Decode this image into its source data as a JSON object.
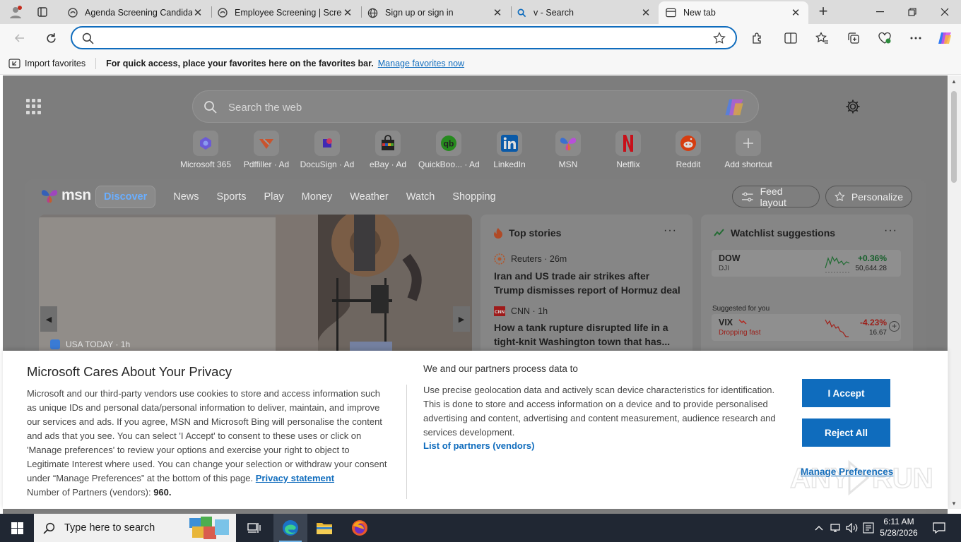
{
  "tabs": [
    {
      "title": "Agenda Screening Candidate",
      "icon": "edge-document-icon",
      "active": false
    },
    {
      "title": "Employee Screening | Screen",
      "icon": "edge-document-icon",
      "active": false
    },
    {
      "title": "Sign up or sign in",
      "icon": "globe-icon",
      "active": false
    },
    {
      "title": "v - Search",
      "icon": "search-icon",
      "active": false
    },
    {
      "title": "New tab",
      "icon": "newtab-icon",
      "active": true
    }
  ],
  "tab_close": "✕",
  "newtab_label": "+",
  "address": {
    "value": "",
    "placeholder": ""
  },
  "favorites": {
    "import_label": "Import favorites",
    "message": "For quick access, place your favorites here on the favorites bar.",
    "manage_link": "Manage favorites now"
  },
  "newtab": {
    "search_placeholder": "Search the web",
    "shortcuts": [
      {
        "label": "Microsoft 365",
        "color": "#6b5bd6"
      },
      {
        "label": "Pdffiller · Ad",
        "color": "#e8572d"
      },
      {
        "label": "DocuSign · Ad",
        "color": "#4b2bd8"
      },
      {
        "label": "eBay · Ad",
        "color": "#2d2d2d"
      },
      {
        "label": "QuickBoo... · Ad",
        "color": "#2ca01c"
      },
      {
        "label": "LinkedIn",
        "color": "#0a66c2"
      },
      {
        "label": "MSN",
        "color": "#8a4fd8"
      },
      {
        "label": "Netflix",
        "color": "#e50914"
      },
      {
        "label": "Reddit",
        "color": "#ff4500"
      },
      {
        "label": "Add shortcut",
        "color": "#bdbdbd"
      }
    ]
  },
  "msn": {
    "logo_text": "msn",
    "nav": [
      "Discover",
      "News",
      "Sports",
      "Play",
      "Money",
      "Weather",
      "Watch",
      "Shopping"
    ],
    "feed_layout": "Feed layout",
    "personalize": "Personalize",
    "hero_source": "USA TODAY · 1h",
    "top_stories": {
      "title": "Top stories",
      "more": "···",
      "items": [
        {
          "source": "Reuters · 26m",
          "title": "Iran and US trade air strikes after Trump dismisses report of Hormuz deal"
        },
        {
          "source": "CNN · 1h",
          "title": "How a tank rupture disrupted life in a tight-knit Washington town that has..."
        }
      ]
    },
    "watchlist": {
      "title": "Watchlist suggestions",
      "more": "···",
      "suggested_label": "Suggested for you",
      "stocks": [
        {
          "name": "DOW",
          "sub": "DJI",
          "change": "+0.36%",
          "value": "50,644.28",
          "color": "#155f2a"
        },
        {
          "name": "VIX",
          "sub": "Dropping fast",
          "change": "-4.23%",
          "value": "16.67",
          "color": "#b3261e"
        }
      ]
    }
  },
  "consent": {
    "title": "Microsoft Cares About Your Privacy",
    "body": "Microsoft and our third-party vendors use cookies to store and access information such as unique IDs and personal data/personal information to deliver, maintain, and improve our services and ads. If you agree, MSN and Microsoft Bing will personalise the content and ads that you see. You can select 'I Accept' to consent to these uses or click on 'Manage preferences' to review your options and exercise your right to object to Legitimate Interest where used. You can change your selection or withdraw your consent under “Manage Preferences” at the bottom of this page.",
    "privacy_link": "Privacy statement",
    "partners_count_label": "Number of Partners (vendors):",
    "partners_count": "960.",
    "subtitle": "We and our partners process data to",
    "purpose": "Use precise geolocation data and actively scan device characteristics for identification. This is done to store and access information on a device and to provide personalised advertising and content, advertising and content measurement, audience research and services development.",
    "partners_link": "List of partners (vendors)",
    "accept": "I Accept",
    "reject": "Reject All",
    "manage": "Manage Preferences"
  },
  "taskbar": {
    "search_placeholder": "Type here to search",
    "time": "6:11 AM",
    "date": "5/28/2026"
  },
  "colors": {
    "accent": "#0f6cbd",
    "taskbar": "#202733"
  }
}
